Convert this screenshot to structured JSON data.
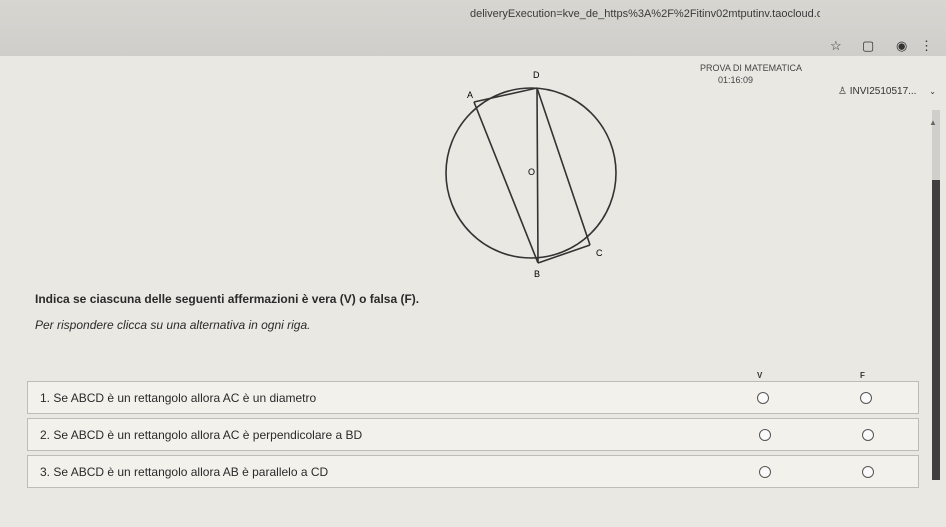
{
  "browser": {
    "url": "deliveryExecution=kve_de_https%3A%2F%2Fitinv02mtputinv.taocloud.or..."
  },
  "header": {
    "title": "PROVA DI MATEMATICA",
    "timer": "01:16:09",
    "user": "INVI2510517..."
  },
  "figure": {
    "labels": {
      "A": "A",
      "B": "B",
      "C": "C",
      "D": "D",
      "O": "O"
    }
  },
  "question": {
    "instruction": "Indica se ciascuna delle seguenti affermazioni è vera (V) o falsa (F).",
    "subinstruction": "Per rispondere clicca su una alternativa in ogni riga.",
    "col_v": "V",
    "col_f": "F",
    "rows": [
      {
        "text": "1. Se ABCD è un rettangolo allora AC è un diametro"
      },
      {
        "text": "2. Se ABCD è un rettangolo allora AC è perpendicolare a BD"
      },
      {
        "text": "3. Se ABCD è un rettangolo allora AB è parallelo a CD"
      }
    ]
  }
}
